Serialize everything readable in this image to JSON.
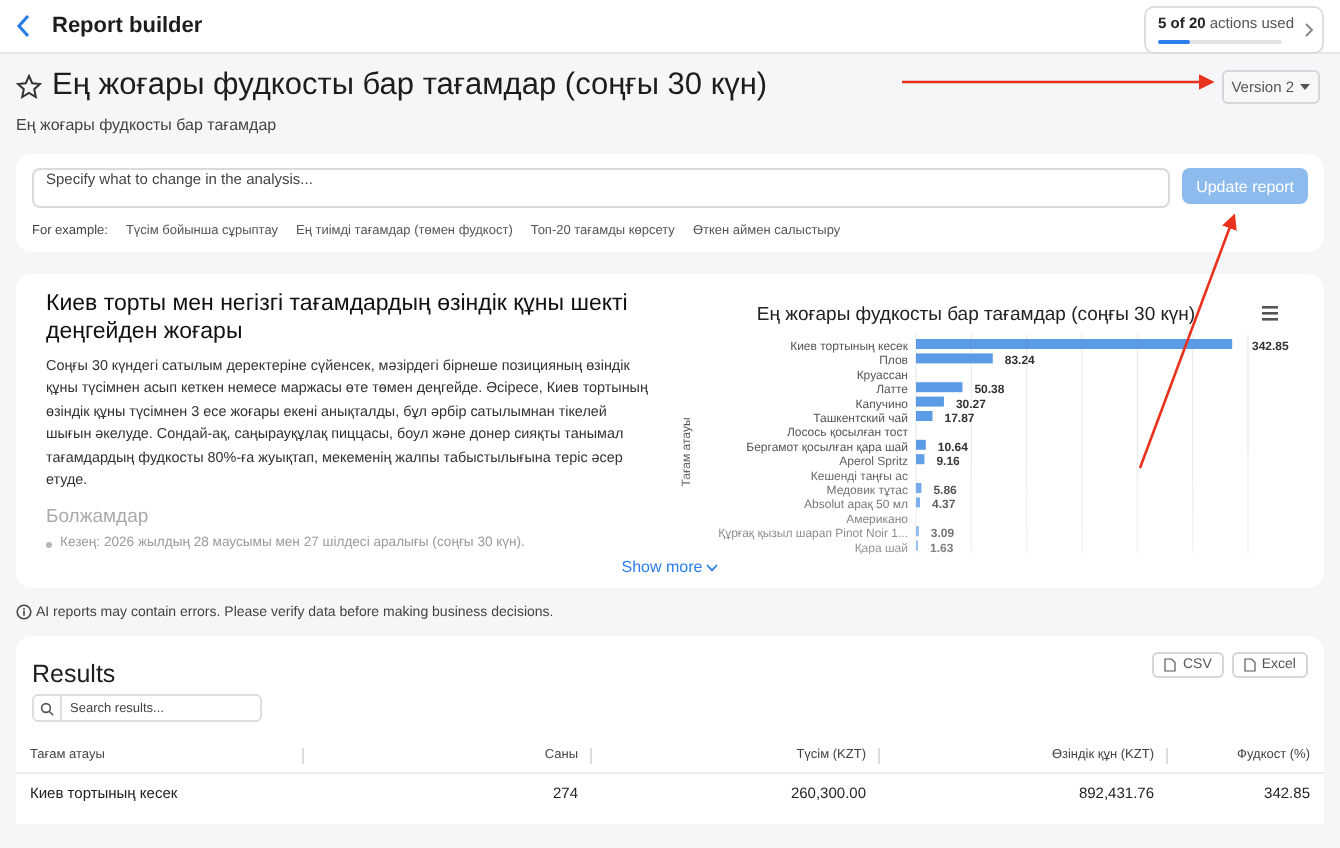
{
  "header": {
    "title": "Report builder",
    "usage": {
      "text": "**5 of 20** actions used",
      "level": 0.25
    }
  },
  "report": {
    "title": "Ең жоғары фудкосты бар тағамдар (соңғы 30 күн)",
    "starred": false,
    "subtitle": "Ең жоғары фудкосты бар тағамдар",
    "version": "Version 2"
  },
  "prompt": {
    "placeholder": "Specify what to change in the analysis...",
    "button": "Update report",
    "disabled": true,
    "examples_label": "For example:",
    "examples": [
      "Түсім бойынша сұрыптау",
      "Ең тиімді тағамдар (төмен фудкост)",
      "Топ-20 тағамды көрсету",
      "Өткен аймен салыстыру"
    ]
  },
  "insight": {
    "heading": "Киев торты мен негізгі тағамдардың өзіндік құны шекті деңгейден жоғары",
    "body": "Соңғы 30 күндегі сатылым деректеріне сүйенсек, мәзірдегі бірнеше позицияның өзіндік құны түсімнен асып кеткен немесе маржасы өте төмен деңгейде. Әсіресе, Киев тортының өзіндік құны түсімнен 3 есе жоғары екені анықталды, бұл әрбір сатылымнан тікелей шығын әкелуде. Сондай-ақ, саңырауқұлақ пиццасы, боул және донер сияқты танымал тағамдардың фудкосты 80%-ға жуықтап, мекеменің жалпы табыстылығына теріс әсер етуде.",
    "section_title": "Болжамдар",
    "bullets": [
      "Кезең: 2026 жылдың 28 маусымы мен 27 шілдесі аралығы (соңғы 30 күн)."
    ],
    "show_more": "Show more",
    "chart_data": {
      "type": "bar",
      "orientation": "horizontal",
      "title": "Ең жоғары фудкосты бар тағамдар (соңғы 30 күн)",
      "ylabel": "Тағам атауы",
      "categories": [
        "Киев тортының кесек",
        "Плов",
        "Круассан",
        "Латте",
        "Капучино",
        "Ташкентский чай",
        "Лосось қосылған тост",
        "Бергамот қосылған қара шай",
        "Aperol Spritz",
        "Кешенді таңғы ас",
        "Медовик тұтас",
        "Absolut арақ 50 мл",
        "Американо",
        "Құрғақ қызыл шарап Pinot Noir 1...",
        "Қара шай"
      ],
      "series": [
        {
          "color": "#5b9be6",
          "values": [
            342.85,
            83.24,
            null,
            50.38,
            30.27,
            17.87,
            null,
            10.64,
            9.16,
            null,
            5.86,
            4.37,
            null,
            3.09,
            1.63
          ]
        }
      ],
      "data_labels": true
    }
  },
  "disclaimer": "AI reports may contain errors. Please verify data before making business decisions.",
  "results": {
    "title": "Results",
    "exports": [
      "CSV",
      "Excel"
    ],
    "search_placeholder": "Search results...",
    "columns": [
      "Тағам атауы",
      "Саны",
      "Түсім (KZT)",
      "Өзіндік құн (KZT)",
      "Фудкост (%)"
    ],
    "rows": [
      [
        "Киев тортының кесек",
        "274",
        "260,300.00",
        "892,431.76",
        "342.85"
      ]
    ]
  }
}
